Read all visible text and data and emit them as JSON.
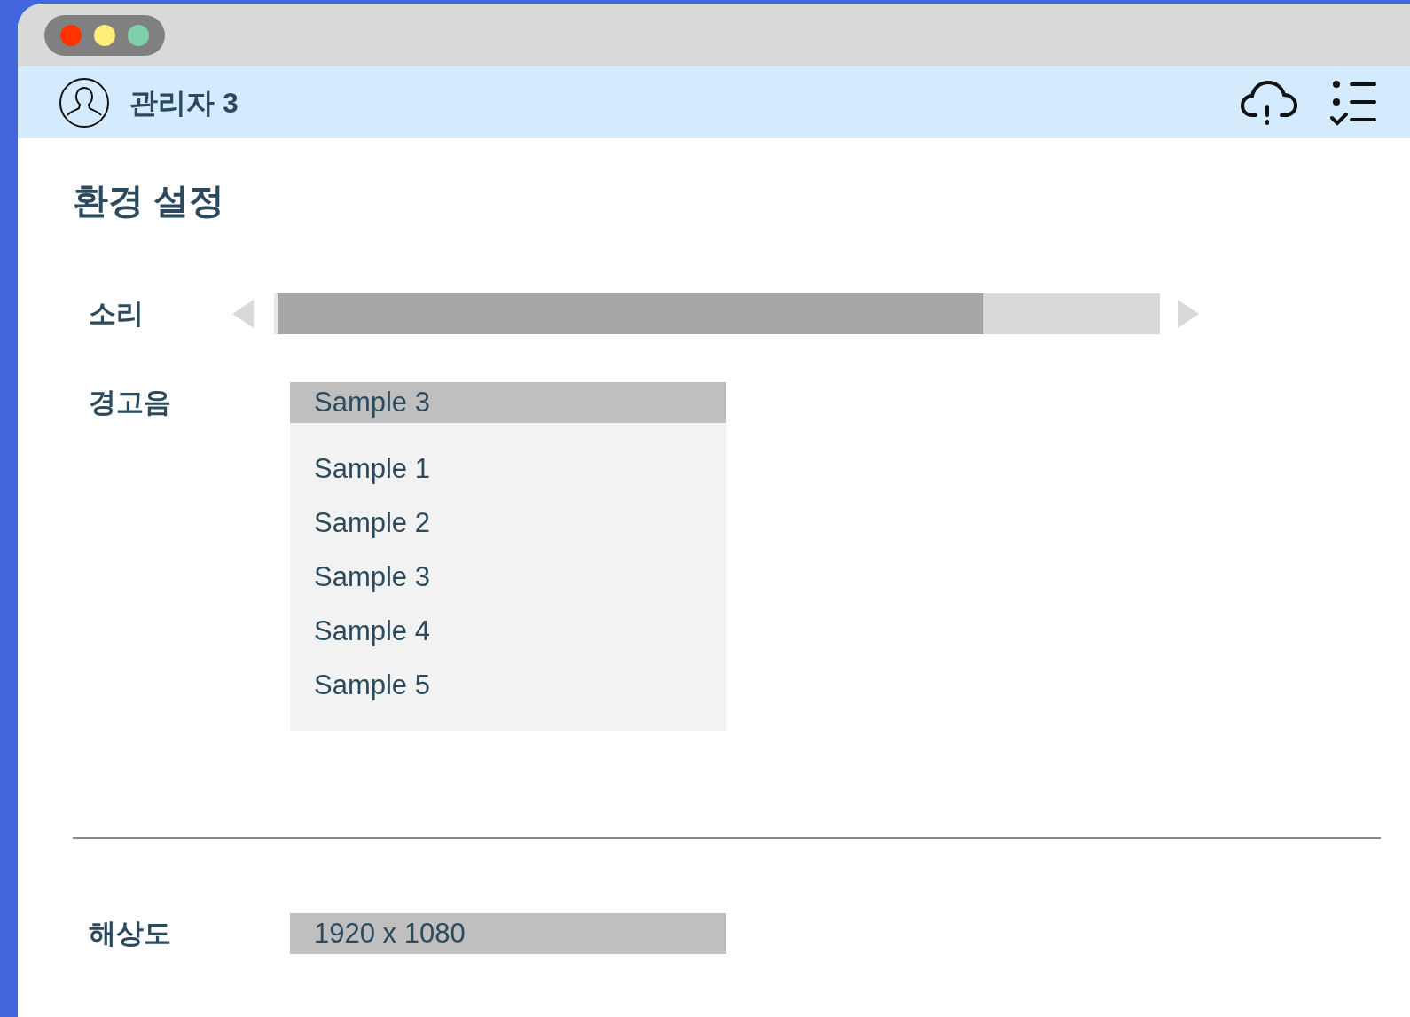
{
  "header": {
    "user_name": "관리자 3"
  },
  "page_title": "환경 설정",
  "sound": {
    "label": "소리",
    "level": 0.8
  },
  "alert_sound": {
    "label": "경고음",
    "value": "Sample 3",
    "expanded": true,
    "options": [
      "Sample 1",
      "Sample 2",
      "Sample 3",
      "Sample 4",
      "Sample 5"
    ]
  },
  "resolution": {
    "label": "해상도",
    "value": "1920 x 1080"
  }
}
